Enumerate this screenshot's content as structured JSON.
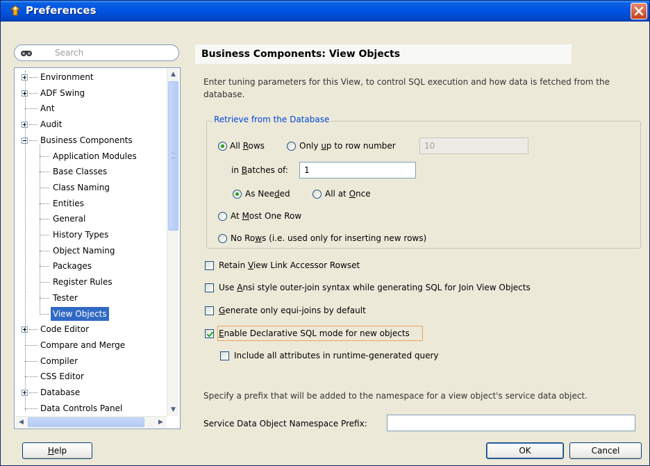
{
  "window": {
    "title": "Preferences"
  },
  "search": {
    "placeholder": "Search"
  },
  "tree": {
    "items": [
      {
        "label": "Environment",
        "expander": "plus"
      },
      {
        "label": "ADF Swing",
        "expander": "plus"
      },
      {
        "label": "Ant",
        "expander": "none"
      },
      {
        "label": "Audit",
        "expander": "plus"
      },
      {
        "label": "Business Components",
        "expander": "minus"
      },
      {
        "label": "Application Modules",
        "child": true
      },
      {
        "label": "Base Classes",
        "child": true
      },
      {
        "label": "Class Naming",
        "child": true
      },
      {
        "label": "Entities",
        "child": true
      },
      {
        "label": "General",
        "child": true
      },
      {
        "label": "History Types",
        "child": true
      },
      {
        "label": "Object Naming",
        "child": true
      },
      {
        "label": "Packages",
        "child": true
      },
      {
        "label": "Register Rules",
        "child": true
      },
      {
        "label": "Tester",
        "child": true
      },
      {
        "label": "View Objects",
        "child": true,
        "selected": true
      },
      {
        "label": "Code Editor",
        "expander": "plus"
      },
      {
        "label": "Compare and Merge",
        "expander": "none"
      },
      {
        "label": "Compiler",
        "expander": "none"
      },
      {
        "label": "CSS Editor",
        "expander": "none"
      },
      {
        "label": "Database",
        "expander": "plus"
      },
      {
        "label": "Data Controls Panel",
        "expander": "none"
      }
    ]
  },
  "page": {
    "title": "Business Components: View Objects",
    "description": "Enter tuning parameters for this View, to control SQL execution and how data is fetched from the database.",
    "retrieve_group": {
      "legend": "Retrieve from the Database",
      "all_rows": "All Rows",
      "only_up_to": "Only up to row number",
      "row_number_value": "10",
      "in_batches_label": "in Batches of:",
      "batches_value": "1",
      "as_needed": "As Needed",
      "all_at_once": "All at Once",
      "at_most_one": "At Most One Row",
      "no_rows": "No Rows (i.e. used only for inserting new rows)"
    },
    "checkboxes": {
      "retain": "Retain View Link Accessor Rowset",
      "ansi": "Use Ansi style outer-join syntax while generating SQL for Join View Objects",
      "equi": "Generate only equi-joins by default",
      "declarative": "Enable Declarative SQL mode for new objects",
      "include_all": "Include all attributes in runtime-generated query"
    },
    "prefix_note": "Specify a prefix that will be added to the namespace for a view object's service data object.",
    "prefix_label": "Service Data Object Namespace Prefix:",
    "prefix_value": ""
  },
  "buttons": {
    "help": "Help",
    "ok": "OK",
    "cancel": "Cancel"
  },
  "colors": {
    "titlebar": "#0054e3",
    "selection": "#316ac5",
    "legend": "#0046d5",
    "check": "#21a121"
  }
}
